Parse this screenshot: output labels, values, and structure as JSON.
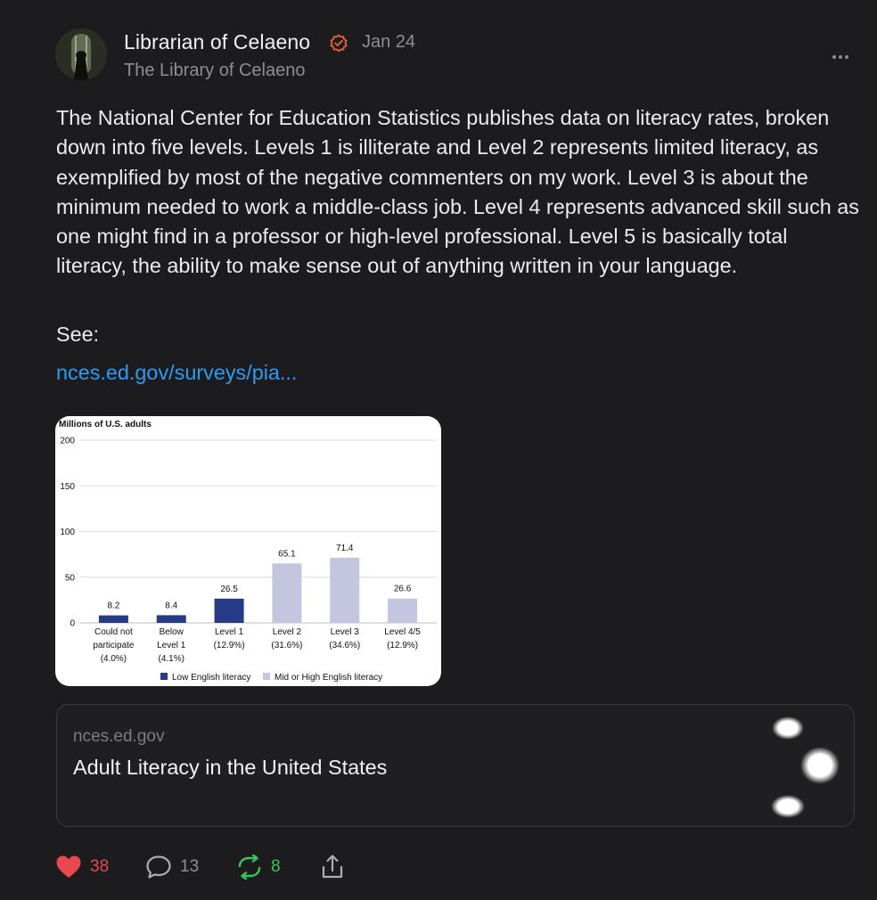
{
  "post": {
    "author": "Librarian of Celaeno",
    "subtitle": "The Library of Celaeno",
    "date": "Jan 24",
    "body": "The National Center for Education Statistics publishes data on literacy rates, broken down into five levels. Levels 1 is illiterate and Level 2 represents limited literacy, as exemplified by most of the negative commenters on my work. Level 3 is about the minimum needed to work a middle-class job. Level 4 represents advanced skill such as one might find in a professor or high-level professional. Level 5 is basically total literacy, the ability to make sense out of anything written in your language.",
    "see_label": "See:",
    "link_text": "nces.ed.gov/surveys/pia..."
  },
  "colors": {
    "accent_link": "#2e9bf0",
    "like": "#e8484f",
    "repost": "#34c759",
    "verified": "#e8643a",
    "low_literacy": "#263a86",
    "mid_high_literacy": "#c3c6de"
  },
  "chart_data": {
    "type": "bar",
    "title": "",
    "ylabel": "Millions of U.S. adults",
    "ylim": [
      0,
      200
    ],
    "yticks": [
      0,
      50,
      100,
      150,
      200
    ],
    "categories": [
      [
        "Could not",
        "participate",
        "(4.0%)"
      ],
      [
        "Below",
        "Level 1",
        "(4.1%)"
      ],
      [
        "Level 1",
        "(12.9%)"
      ],
      [
        "Level 2",
        "(31.6%)"
      ],
      [
        "Level 3",
        "(34.6%)"
      ],
      [
        "Level 4/5",
        "(12.9%)"
      ]
    ],
    "values": [
      8.2,
      8.4,
      26.5,
      65.1,
      71.4,
      26.6
    ],
    "value_labels": [
      "8.2",
      "8.4",
      "26.5",
      "65.1",
      "71.4",
      "26.6"
    ],
    "groups": [
      "low",
      "low",
      "low",
      "mid",
      "mid",
      "mid"
    ],
    "legend": [
      {
        "key": "low",
        "label": "Low English literacy"
      },
      {
        "key": "mid",
        "label": "Mid or High English literacy"
      }
    ],
    "grid": true,
    "legend_position": "bottom"
  },
  "link_card": {
    "domain": "nces.ed.gov",
    "title": "Adult Literacy in the United States"
  },
  "actions": {
    "likes": "38",
    "comments": "13",
    "reposts": "8"
  },
  "icons": [
    "avatar",
    "verified-icon",
    "more-icon",
    "heart-icon",
    "comment-icon",
    "repost-icon",
    "share-icon"
  ]
}
